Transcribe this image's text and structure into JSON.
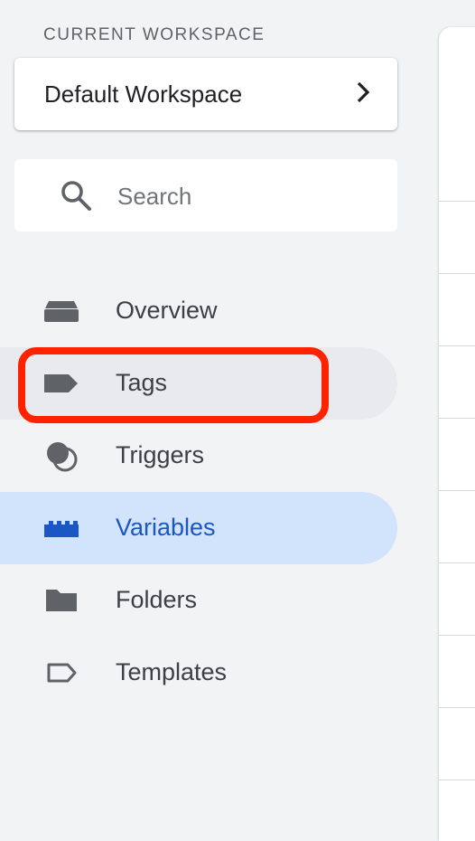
{
  "workspace": {
    "section_label": "CURRENT WORKSPACE",
    "name": "Default Workspace"
  },
  "search": {
    "placeholder": "Search",
    "value": ""
  },
  "nav": {
    "items": [
      {
        "label": "Overview",
        "icon": "overview-icon",
        "state": "normal"
      },
      {
        "label": "Tags",
        "icon": "tag-icon",
        "state": "hover-highlighted"
      },
      {
        "label": "Triggers",
        "icon": "triggers-icon",
        "state": "normal"
      },
      {
        "label": "Variables",
        "icon": "variables-icon",
        "state": "active"
      },
      {
        "label": "Folders",
        "icon": "folder-icon",
        "state": "normal"
      },
      {
        "label": "Templates",
        "icon": "template-icon",
        "state": "normal"
      }
    ]
  },
  "colors": {
    "active_bg": "#d2e3fc",
    "active_text": "#1a56c4",
    "highlight_outline": "#ff2200",
    "sidebar_bg": "#f1f3f4"
  }
}
